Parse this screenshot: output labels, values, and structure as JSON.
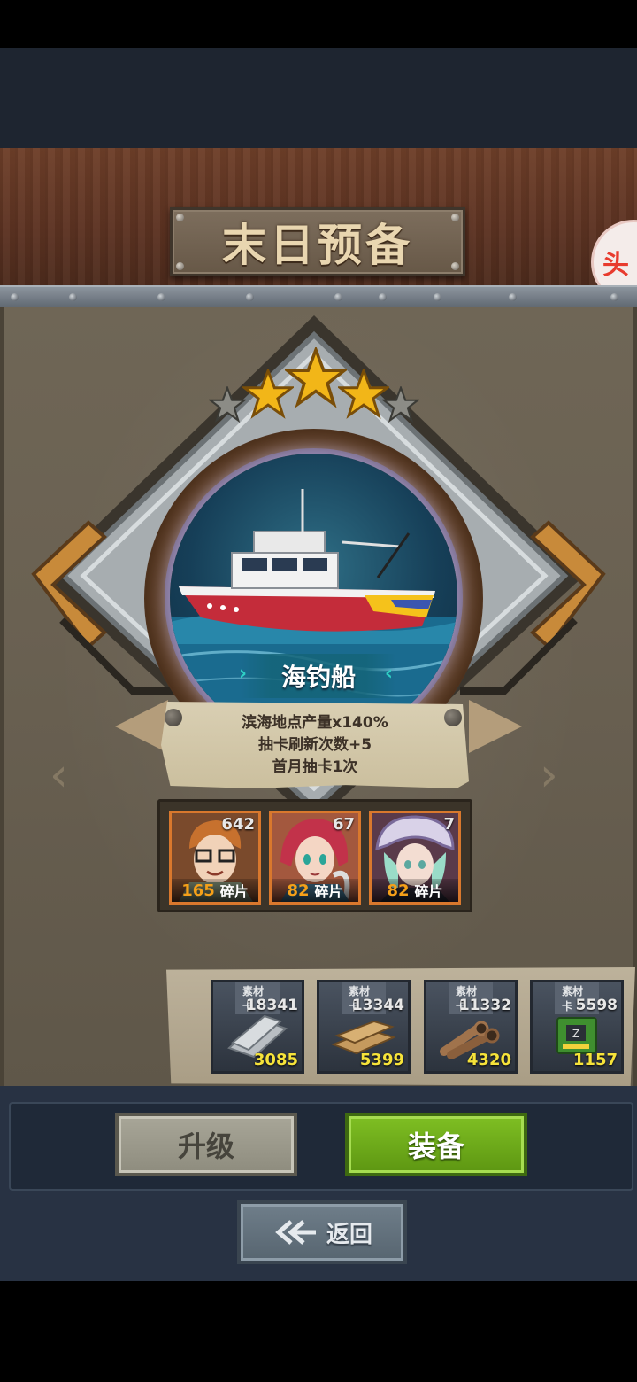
{
  "title": "末日预备",
  "corner_badge": "头",
  "item": {
    "name": "海钓船",
    "stars_filled": 3,
    "stars_total": 5,
    "effects": [
      "滨海地点产量x140%",
      "抽卡刷新次数+5",
      "首月抽卡1次"
    ]
  },
  "characters": [
    {
      "count": "642",
      "shards": "165",
      "shard_label": "碎片"
    },
    {
      "count": "67",
      "shards": "82",
      "shard_label": "碎片"
    },
    {
      "count": "7",
      "shards": "82",
      "shard_label": "碎片"
    }
  ],
  "materials": [
    {
      "tag": "素材卡",
      "owned": "18341",
      "need": "3085",
      "icon": "metal-plate-icon"
    },
    {
      "tag": "素材卡",
      "owned": "13344",
      "need": "5399",
      "icon": "wood-plank-icon"
    },
    {
      "tag": "素材卡",
      "owned": "11332",
      "need": "4320",
      "icon": "pipe-icon"
    },
    {
      "tag": "素材卡",
      "owned": "5598",
      "need": "1157",
      "icon": "chip-icon"
    }
  ],
  "buttons": {
    "upgrade": "升级",
    "equip": "装备",
    "back": "返回"
  },
  "colors": {
    "equip_green": "#6aa81a",
    "star_gold": "#f2b618",
    "rarity_orange": "#d9782d"
  }
}
